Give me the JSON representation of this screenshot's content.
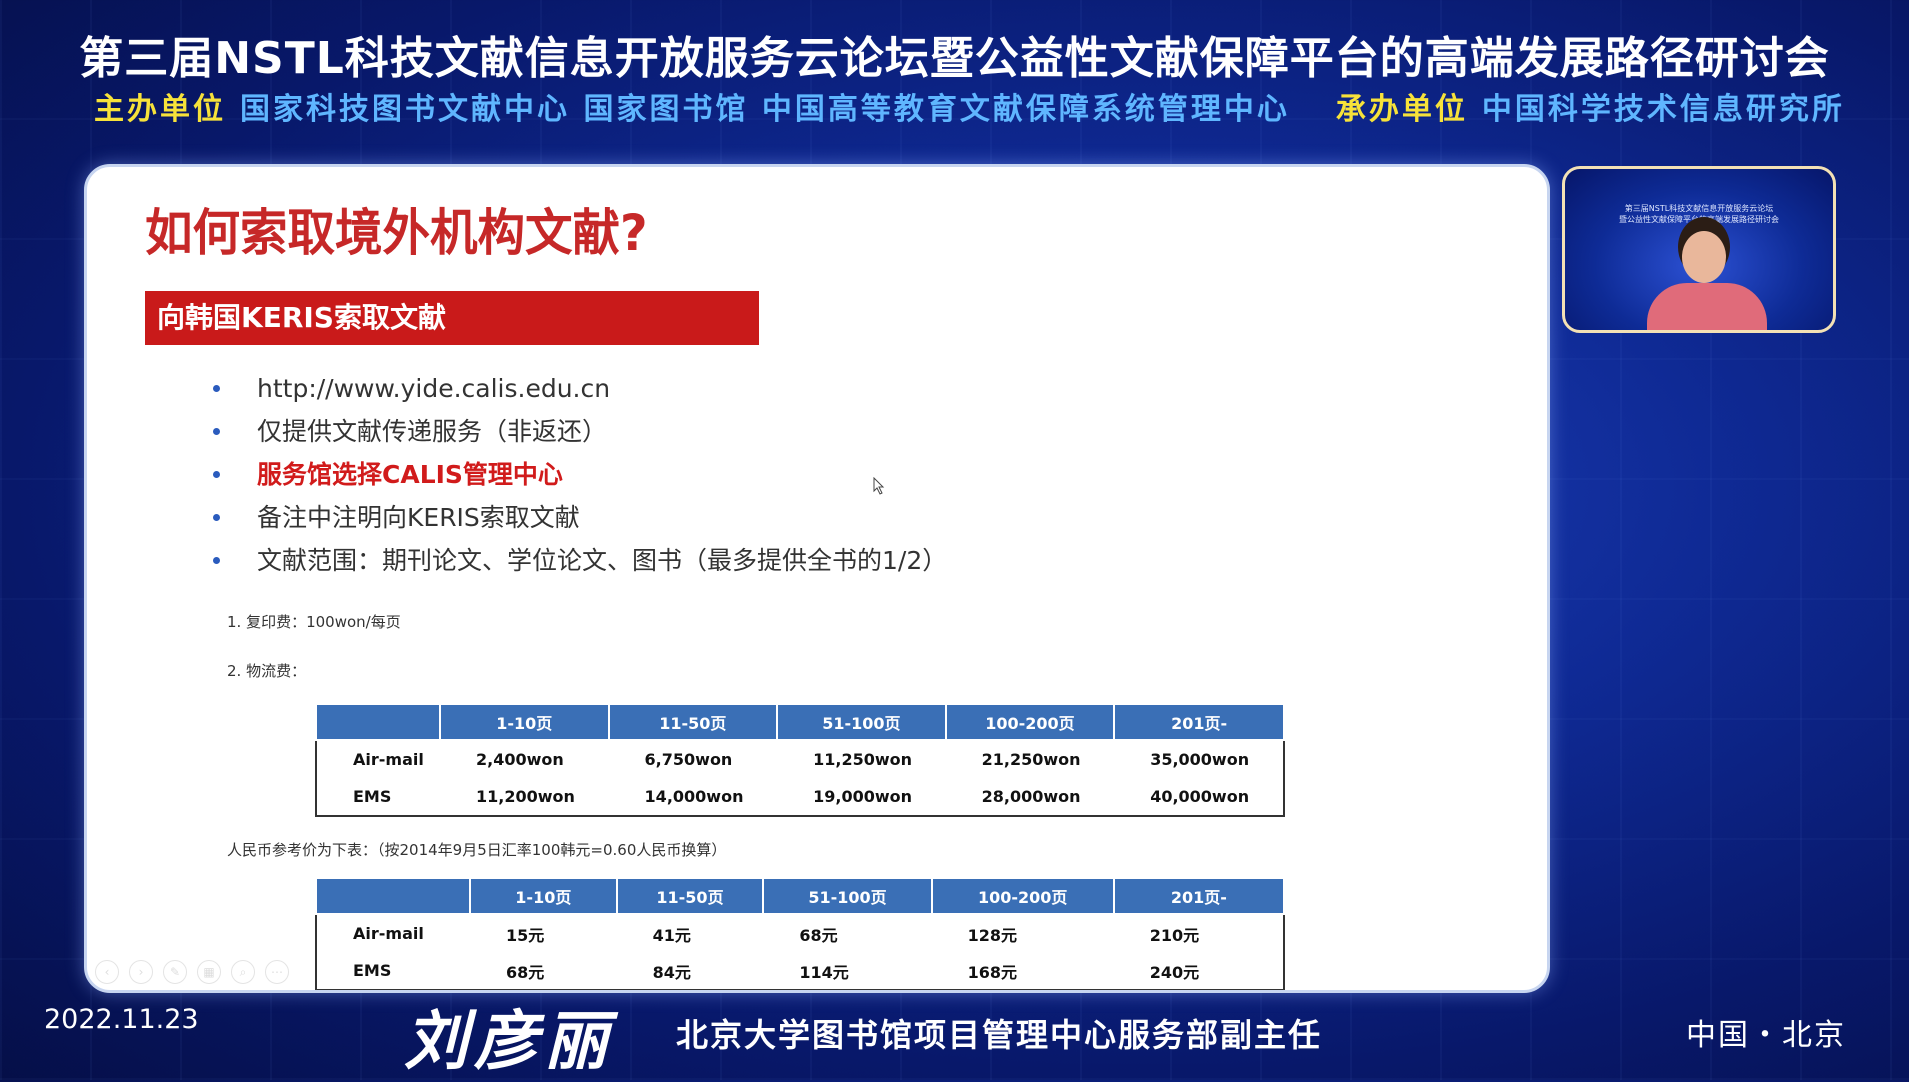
{
  "header": {
    "event_title": "第三届NSTL科技文献信息开放服务云论坛暨公益性文献保障平台的高端发展路径研讨会",
    "organizer_label": "主办单位",
    "organizer_value": "国家科技图书文献中心 国家图书馆 中国高等教育文献保障系统管理中心",
    "host_label": "承办单位",
    "host_value": "中国科学技术信息研究所"
  },
  "slide": {
    "title": "如何索取境外机构文献?",
    "banner": "向韩国KERIS索取文献",
    "bullets": [
      "http://www.yide.calis.edu.cn",
      "仅提供文献传递服务（非返还）",
      "服务馆选择CALIS管理中心",
      "备注中注明向KERIS索取文献",
      "文献范围：期刊论文、学位论文、图书（最多提供全书的1/2）"
    ],
    "note_copy_fee": "1. 复印费：100won/每页",
    "note_shipping": "2. 物流费：",
    "note_rmb": "人民币参考价为下表：（按2014年9月5日汇率100韩元=0.60人民币换算）",
    "table_won": {
      "headers": [
        "",
        "1-10页",
        "11-50页",
        "51-100页",
        "100-200页",
        "201页-"
      ],
      "rows": [
        [
          "Air-mail",
          "2,400won",
          "6,750won",
          "11,250won",
          "21,250won",
          "35,000won"
        ],
        [
          "EMS",
          "11,200won",
          "14,000won",
          "19,000won",
          "28,000won",
          "40,000won"
        ]
      ]
    },
    "table_rmb": {
      "headers": [
        "",
        "1-10页",
        "11-50页",
        "51-100页",
        "100-200页",
        "201页-"
      ],
      "rows": [
        [
          "Air-mail",
          "15元",
          "41元",
          "68元",
          "128元",
          "210元"
        ],
        [
          "EMS",
          "68元",
          "84元",
          "114元",
          "168元",
          "240元"
        ]
      ]
    }
  },
  "webcam": {
    "caption_line1": "第三届NSTL科技文献信息开放服务云论坛",
    "caption_line2": "暨公益性文献保障平台的高端发展路径研讨会"
  },
  "footer": {
    "date": "2022.11.23",
    "speaker_name": "刘彦丽",
    "speaker_role": "北京大学图书馆项目管理中心服务部副主任",
    "location": "中国・北京"
  }
}
